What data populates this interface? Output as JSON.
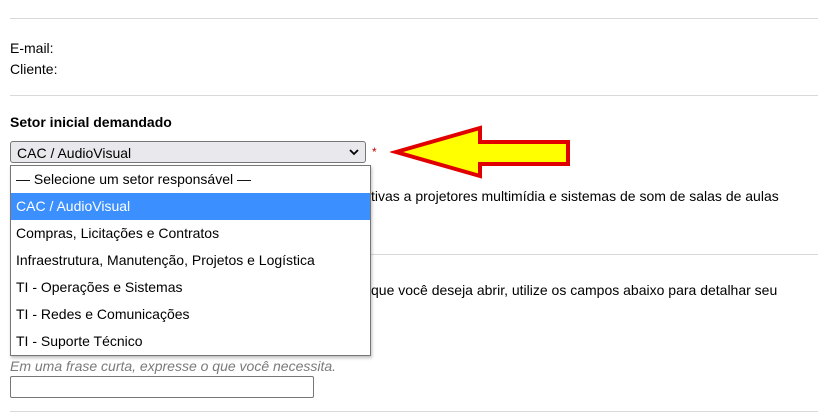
{
  "contact": {
    "email_label": "E-mail:",
    "cliente_label": "Cliente:"
  },
  "setor": {
    "heading": "Setor inicial demandado",
    "selected": "CAC / AudioVisual",
    "required_mark": "*",
    "options": [
      "— Selecione um setor responsável —",
      "CAC / AudioVisual",
      "Compras, Licitações e Contratos",
      "Infraestrutura, Manutenção, Projetos e Logística",
      "TI - Operações e Sistemas",
      "TI - Redes e Comunicações",
      "TI - Suporte Técnico"
    ],
    "selected_index": 1,
    "description_partial": "tivas a projetores multimídia e sistemas de som de salas de aulas"
  },
  "details": {
    "instructions_partial": "que você deseja abrir, utilize os campos abaixo para detalhar seu",
    "hint": "Em uma frase curta, expresse o que você necessita.",
    "summary_value": ""
  },
  "colors": {
    "highlight": "#3b8fff",
    "arrow_fill": "#ffff00",
    "arrow_stroke": "#e00000",
    "required": "#c00000"
  },
  "icons": {
    "dropdown": "chevron-down-icon",
    "annotation": "arrow-left-icon"
  }
}
